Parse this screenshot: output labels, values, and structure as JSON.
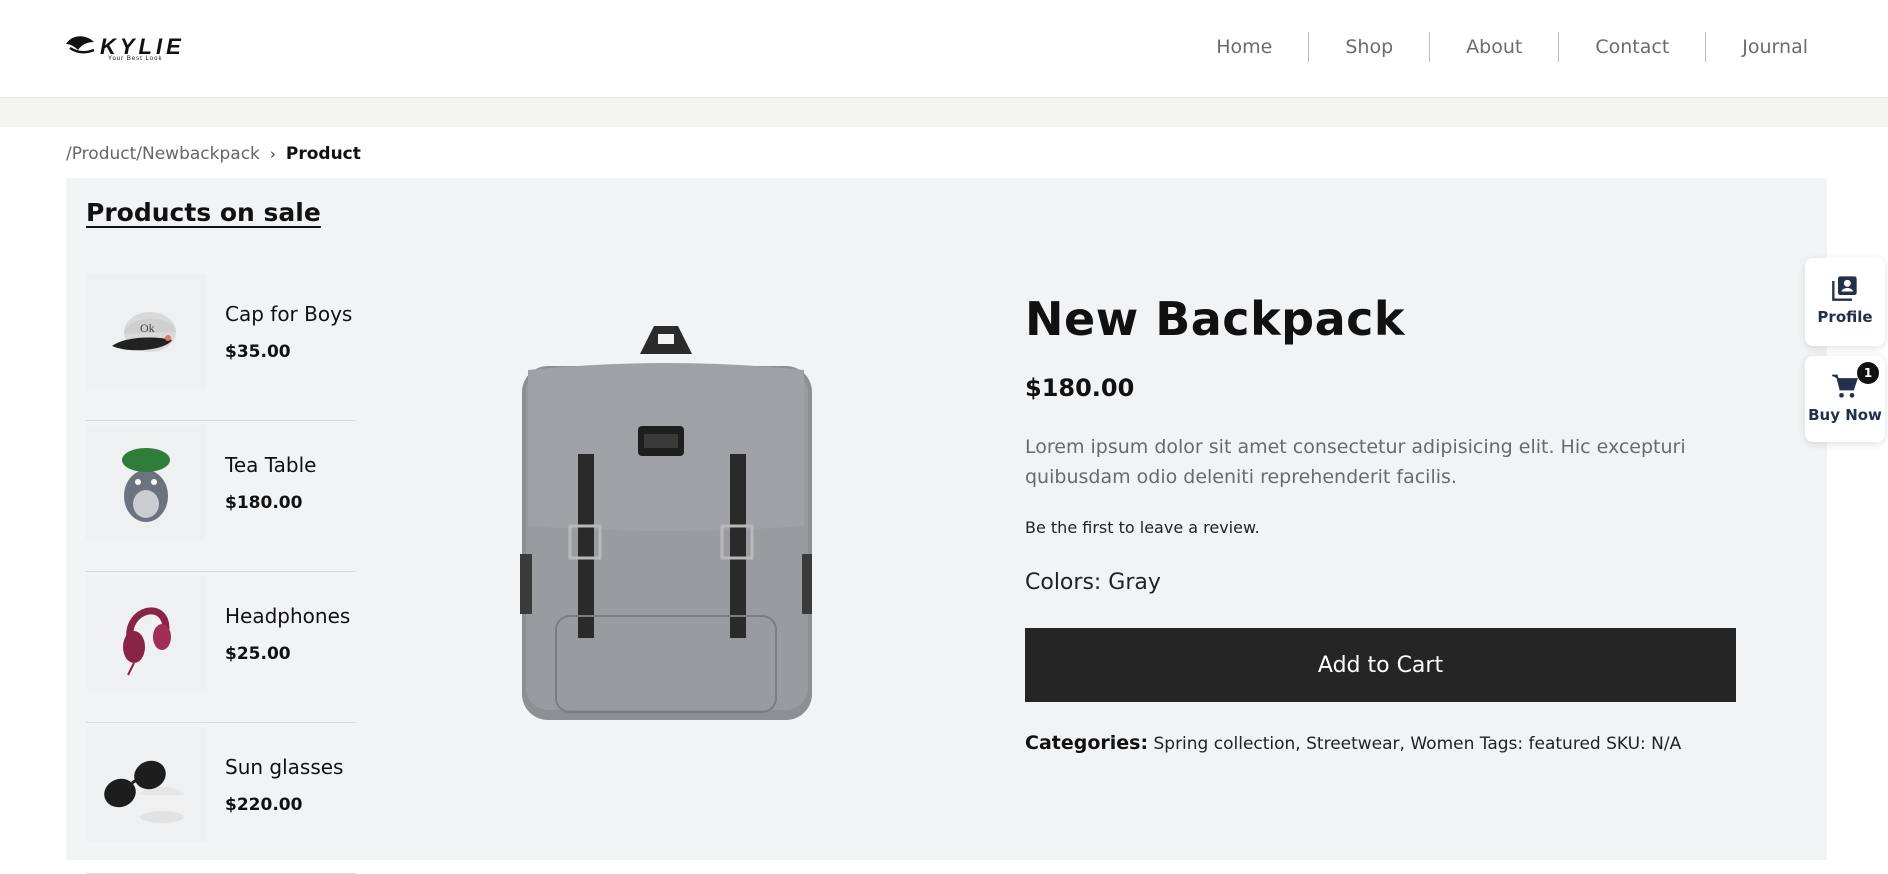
{
  "logo": {
    "brand": "KYLIE",
    "tagline": "Your Best Look"
  },
  "nav": {
    "items": [
      "Home",
      "Shop",
      "About",
      "Contact",
      "Journal"
    ]
  },
  "breadcrumb": {
    "path": "/Product/Newbackpack",
    "separator": "›",
    "current": "Product"
  },
  "sidebar": {
    "title": "Products on sale",
    "products": [
      {
        "name": "Cap for Boys",
        "price": "$35.00",
        "icon": "cap-image"
      },
      {
        "name": "Tea Table",
        "price": "$180.00",
        "icon": "figurine-image"
      },
      {
        "name": "Headphones",
        "price": "$25.00",
        "icon": "headphones-image"
      },
      {
        "name": "Sun glasses",
        "price": "$220.00",
        "icon": "sunglasses-image"
      }
    ]
  },
  "product": {
    "title": "New Backpack",
    "price": "$180.00",
    "description": "Lorem ipsum dolor sit amet consectetur adipisicing elit. Hic excepturi quibusdam odio deleniti reprehenderit facilis.",
    "review_prompt": "Be the first to leave a review.",
    "colors": "Colors: Gray",
    "add_to_cart": "Add to Cart",
    "categories_label": "Categories:",
    "categories_text": "Spring collection, Streetwear, Women Tags: featured SKU: N/A",
    "image": "backpack-image"
  },
  "floating": {
    "profile_label": "Profile",
    "buy_label": "Buy Now",
    "cart_count": "1"
  },
  "colors": {
    "button": "#252525",
    "panel": "#f2f3f5",
    "widget_text": "#24304a"
  }
}
